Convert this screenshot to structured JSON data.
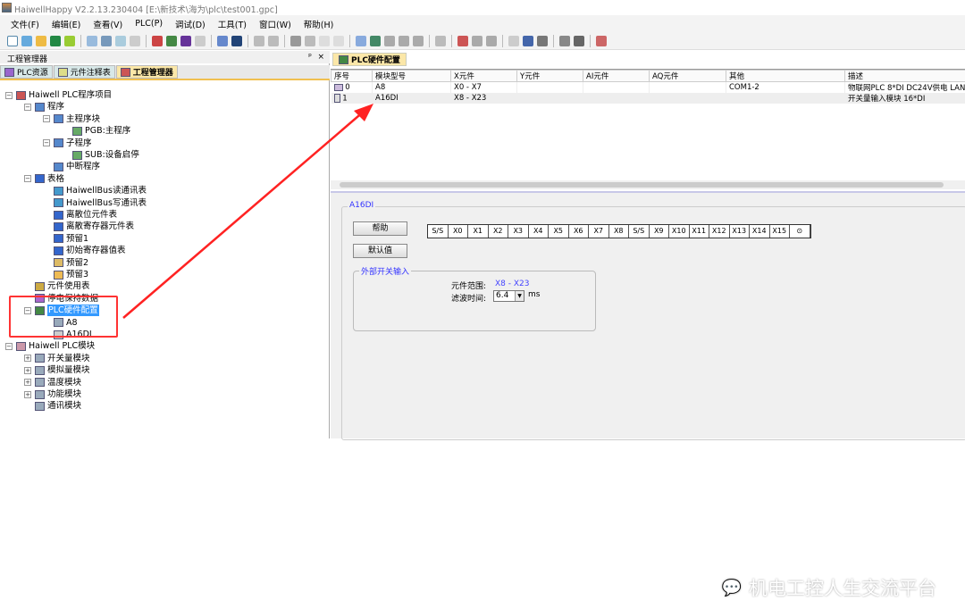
{
  "window": {
    "title": "HaiwellHappy V2.2.13.230404 [E:\\新技术\\海为\\plc\\test001.gpc]"
  },
  "menu": [
    "文件(F)",
    "编辑(E)",
    "查看(V)",
    "PLC(P)",
    "调试(D)",
    "工具(T)",
    "窗口(W)",
    "帮助(H)"
  ],
  "left_panel": {
    "title": "工程管理器",
    "pin": "ᵖ",
    "close": "×",
    "tabs": [
      {
        "label": "PLC资源"
      },
      {
        "label": "元件注释表"
      },
      {
        "label": "工程管理器"
      }
    ],
    "tree": [
      {
        "label": "Haiwell PLC程序项目",
        "level": 0,
        "exp": "−"
      },
      {
        "label": "程序",
        "level": 1,
        "exp": "−"
      },
      {
        "label": "主程序块",
        "level": 2,
        "exp": "−"
      },
      {
        "label": "PGB:主程序",
        "level": 3
      },
      {
        "label": "子程序",
        "level": 2,
        "exp": "−"
      },
      {
        "label": "SUB:设备启停",
        "level": 3
      },
      {
        "label": "中断程序",
        "level": 2
      },
      {
        "label": "表格",
        "level": 1,
        "exp": "−"
      },
      {
        "label": "HaiwellBus读通讯表",
        "level": 2
      },
      {
        "label": "HaiwellBus写通讯表",
        "level": 2
      },
      {
        "label": "离散位元件表",
        "level": 2
      },
      {
        "label": "离散寄存器元件表",
        "level": 2
      },
      {
        "label": "预留1",
        "level": 2
      },
      {
        "label": "初始寄存器值表",
        "level": 2
      },
      {
        "label": "预留2",
        "level": 2
      },
      {
        "label": "预留3",
        "level": 2
      },
      {
        "label": "元件使用表",
        "level": 1
      },
      {
        "label": "停电保持数据",
        "level": 1
      },
      {
        "label": "PLC硬件配置",
        "level": 1,
        "exp": "−",
        "selected": true
      },
      {
        "label": "A8",
        "level": 2
      },
      {
        "label": "A16DI",
        "level": 2
      },
      {
        "label": "Haiwell PLC模块",
        "level": 0,
        "exp": "−"
      },
      {
        "label": "开关量模块",
        "level": 1,
        "exp": "+"
      },
      {
        "label": "模拟量模块",
        "level": 1,
        "exp": "+"
      },
      {
        "label": "温度模块",
        "level": 1,
        "exp": "+"
      },
      {
        "label": "功能模块",
        "level": 1,
        "exp": "+"
      },
      {
        "label": "通讯模块",
        "level": 1
      }
    ]
  },
  "doc_tab": "PLC硬件配置",
  "table": {
    "headers": [
      "序号",
      "模块型号",
      "X元件",
      "Y元件",
      "AI元件",
      "AQ元件",
      "其他",
      "描述"
    ],
    "rows": [
      [
        "0",
        "A8",
        "X0 - X7",
        "",
        "",
        "",
        "COM1-2",
        "物联网PLC 8*DI DC24V供电 LAN"
      ],
      [
        "1",
        "A16DI",
        "X8 - X23",
        "",
        "",
        "",
        "",
        "开关量输入模块 16*DI"
      ]
    ]
  },
  "module_panel": {
    "title": "A16DI",
    "help_button": "帮助",
    "default_button": "默认值",
    "pins": [
      "S/S",
      "X0",
      "X1",
      "X2",
      "X3",
      "X4",
      "X5",
      "X6",
      "X7",
      "X8",
      "S/S",
      "X9",
      "X10",
      "X11",
      "X12",
      "X13",
      "X14",
      "X15",
      "⊙"
    ],
    "group_title": "外部开关输入",
    "range_label": "元件范围:",
    "range_value": "X8 - X23",
    "filter_label": "滤波时间:",
    "filter_value": "6.4",
    "filter_unit": "ms"
  },
  "watermark": "机电工控人生交流平台",
  "colors": {
    "highlight": "#f33",
    "selection": "#3399ff",
    "tab_active": "#fbe7a8",
    "link": "#3333ff"
  }
}
